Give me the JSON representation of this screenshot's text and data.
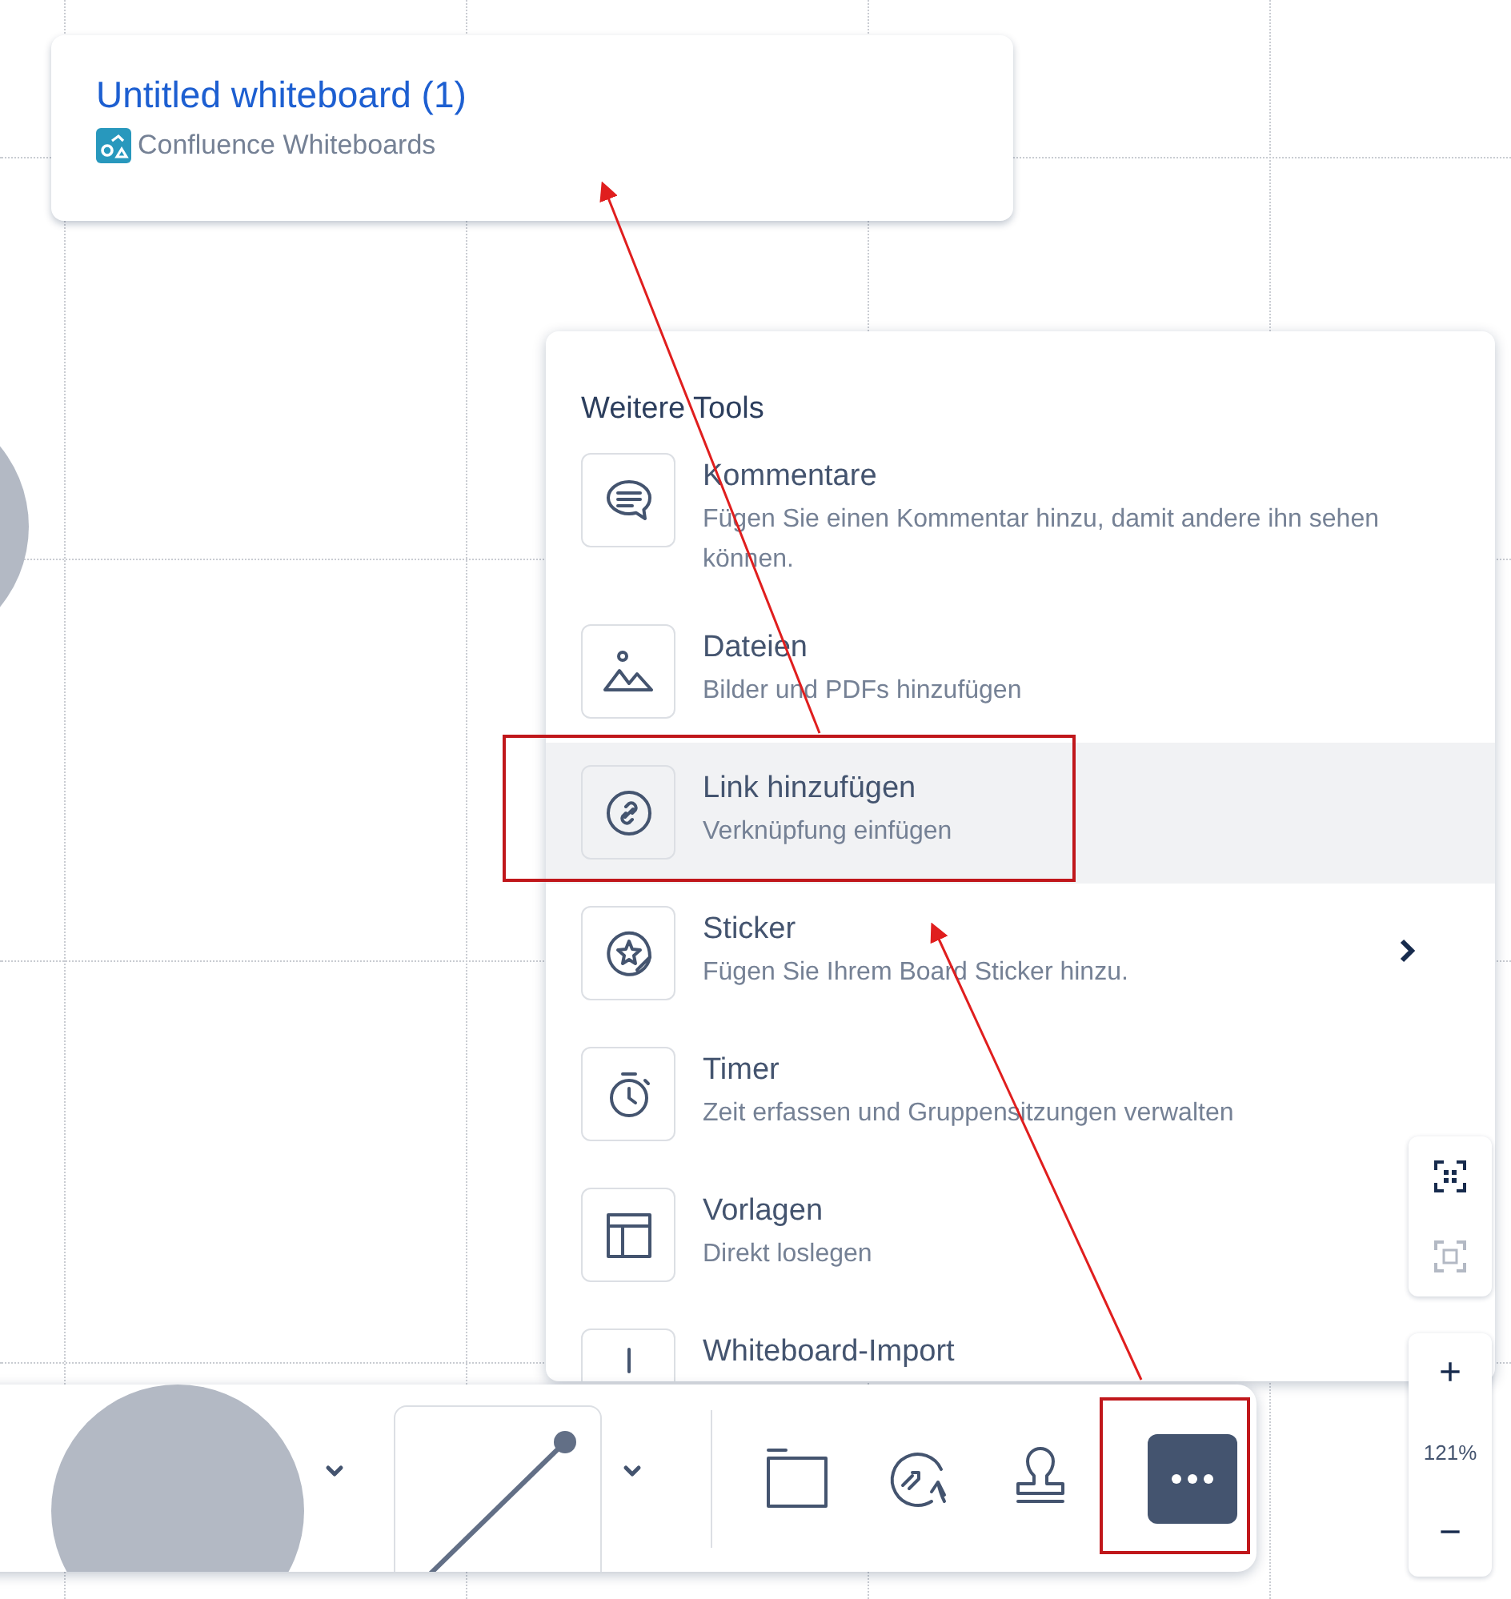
{
  "card": {
    "title": "Untitled whiteboard (1)",
    "source": "Confluence Whiteboards"
  },
  "menu": {
    "title": "Weitere Tools",
    "items": [
      {
        "kind": "comment",
        "label": "Kommentare",
        "description": "Fügen Sie einen Kommentar hinzu, damit andere ihn sehen können.",
        "selected": false,
        "submenu": false
      },
      {
        "kind": "files",
        "label": "Dateien",
        "description": "Bilder und PDFs hinzufügen",
        "selected": false,
        "submenu": false
      },
      {
        "kind": "link",
        "label": "Link hinzufügen",
        "description": "Verknüpfung einfügen",
        "selected": true,
        "submenu": false
      },
      {
        "kind": "sticker",
        "label": "Sticker",
        "description": "Fügen Sie Ihrem Board Sticker hinzu.",
        "selected": false,
        "submenu": true
      },
      {
        "kind": "timer",
        "label": "Timer",
        "description": "Zeit erfassen und Gruppensitzungen verwalten",
        "selected": false,
        "submenu": false
      },
      {
        "kind": "templates",
        "label": "Vorlagen",
        "description": "Direkt loslegen",
        "selected": false,
        "submenu": false
      },
      {
        "kind": "import",
        "label": "Whiteboard-Import",
        "selected": false,
        "submenu": false
      }
    ]
  },
  "view_controls": [
    {
      "kind": "fit",
      "disabled": false
    },
    {
      "kind": "selection",
      "disabled": true
    }
  ],
  "zoom": {
    "in": "+",
    "level": "121%",
    "out": "−"
  },
  "toolbar": [
    {
      "kind": "shape",
      "selected": false
    },
    {
      "kind": "line",
      "selected": false
    },
    {
      "kind": "frame",
      "selected": false
    },
    {
      "kind": "smart",
      "selected": false
    },
    {
      "kind": "stamp",
      "selected": false
    },
    {
      "kind": "more",
      "selected": true
    }
  ]
}
